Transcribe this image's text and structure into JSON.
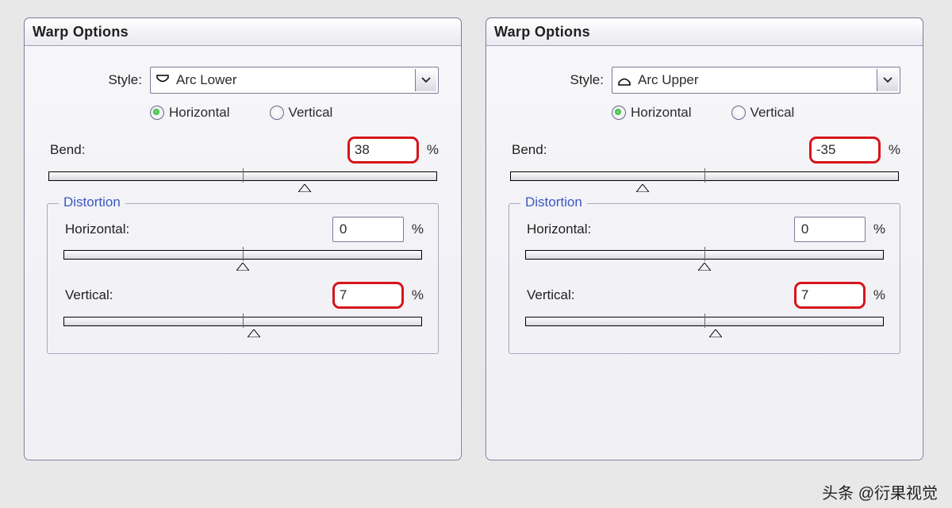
{
  "dialogs": [
    {
      "title": "Warp Options",
      "style_label": "Style:",
      "style_value": "Arc Lower",
      "style_icon": "arc-lower-icon",
      "orientation": {
        "horizontal": "Horizontal",
        "vertical": "Vertical",
        "selected": "horizontal"
      },
      "bend": {
        "label": "Bend:",
        "value": "38",
        "unit": "%",
        "highlight": true,
        "thumb_pct": 66
      },
      "distortion": {
        "legend": "Distortion",
        "horizontal": {
          "label": "Horizontal:",
          "value": "0",
          "unit": "%",
          "highlight": false,
          "thumb_pct": 50
        },
        "vertical": {
          "label": "Vertical:",
          "value": "7",
          "unit": "%",
          "highlight": true,
          "thumb_pct": 53
        }
      }
    },
    {
      "title": "Warp Options",
      "style_label": "Style:",
      "style_value": "Arc Upper",
      "style_icon": "arc-upper-icon",
      "orientation": {
        "horizontal": "Horizontal",
        "vertical": "Vertical",
        "selected": "horizontal"
      },
      "bend": {
        "label": "Bend:",
        "value": "-35",
        "unit": "%",
        "highlight": true,
        "thumb_pct": 34
      },
      "distortion": {
        "legend": "Distortion",
        "horizontal": {
          "label": "Horizontal:",
          "value": "0",
          "unit": "%",
          "highlight": false,
          "thumb_pct": 50
        },
        "vertical": {
          "label": "Vertical:",
          "value": "7",
          "unit": "%",
          "highlight": true,
          "thumb_pct": 53
        }
      }
    }
  ],
  "watermark": "头条 @衍果视觉"
}
